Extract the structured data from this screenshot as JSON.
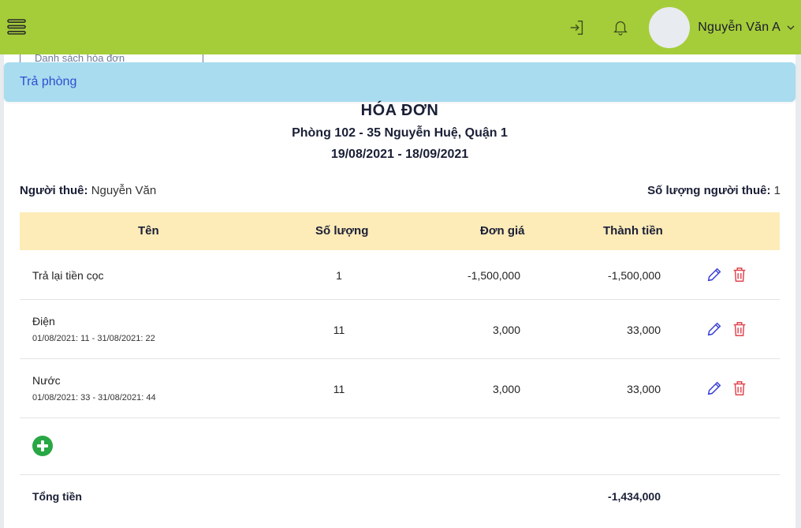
{
  "header": {
    "user_name": "Nguyễn Văn A",
    "icons": [
      "menu-icon",
      "login-icon",
      "bell-icon",
      "chevron-down-icon"
    ],
    "brand_color": "#a5cd39"
  },
  "background_tab": {
    "label": "Danh sách hóa đơn"
  },
  "modal": {
    "title": "Trả phòng",
    "header_color": "#a9dcef"
  },
  "invoice": {
    "title": "HÓA ĐƠN",
    "room": "Phòng 102 - 35 Nguyễn Huệ, Quận 1",
    "period": "19/08/2021 - 18/09/2021",
    "tenant_label": "Người thuê:",
    "tenant_value": "Nguyễn Văn",
    "tenant_count_label": "Số lượng người thuê:",
    "tenant_count_value": "1"
  },
  "table": {
    "headers": {
      "name": "Tên",
      "qty": "Số lượng",
      "price": "Đơn giá",
      "total": "Thành tiền"
    },
    "header_color": "#fdebb8",
    "rows": [
      {
        "name": "Trả lại tiền cọc",
        "sub": "",
        "qty": "1",
        "price": "-1,500,000",
        "total": "-1,500,000"
      },
      {
        "name": "Điện",
        "sub": "01/08/2021: 11 - 31/08/2021: 22",
        "qty": "11",
        "price": "3,000",
        "total": "33,000"
      },
      {
        "name": "Nước",
        "sub": "01/08/2021: 33 - 31/08/2021: 44",
        "qty": "11",
        "price": "3,000",
        "total": "33,000"
      }
    ],
    "total_label": "Tổng tiền",
    "total_value": "-1,434,000"
  },
  "colors": {
    "edit": "#3a3fd6",
    "delete": "#e0454f",
    "add": "#28a745"
  }
}
